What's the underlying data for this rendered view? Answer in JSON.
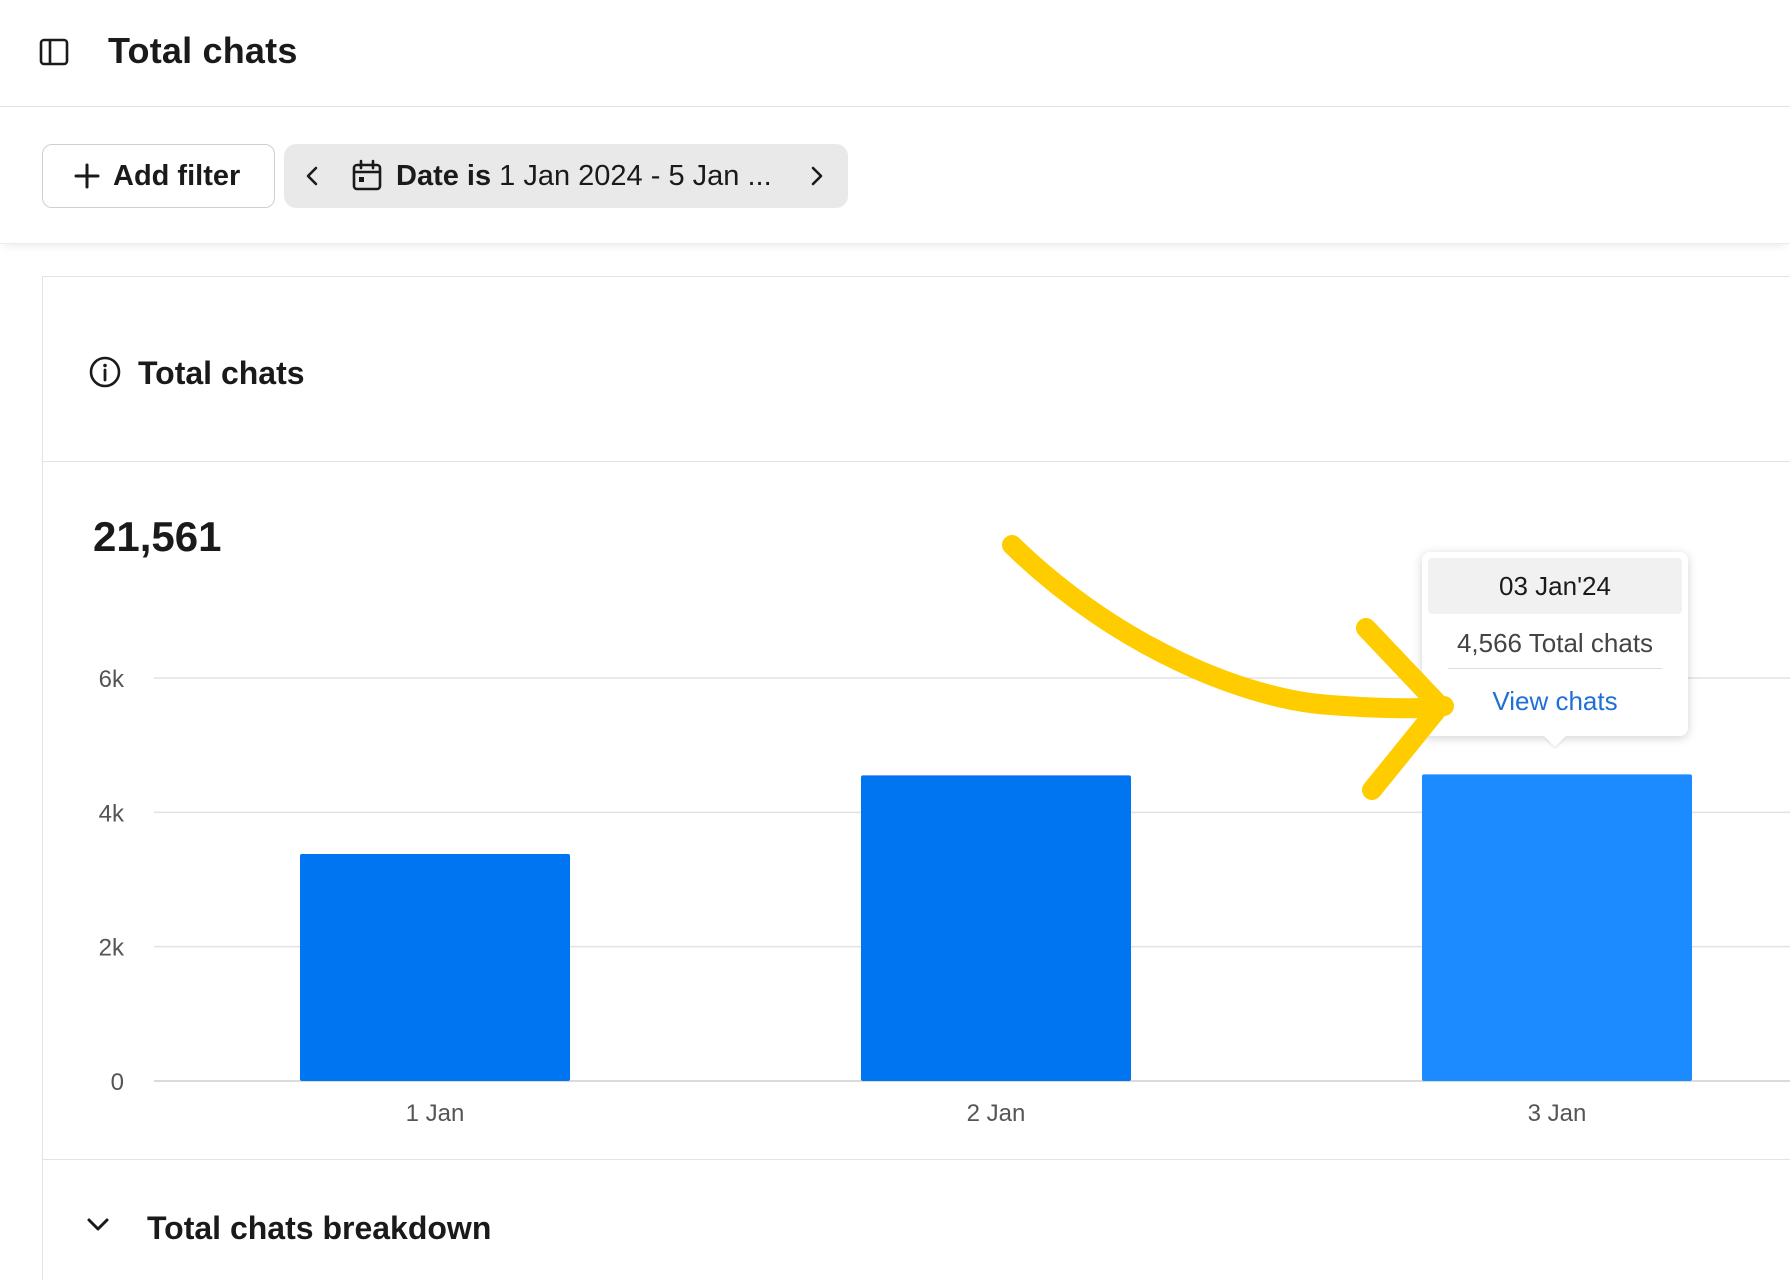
{
  "header": {
    "title": "Total chats",
    "sidebar_toggle_icon": "sidebar-toggle-icon"
  },
  "filters": {
    "add_filter_label": "Add filter",
    "date_chip": {
      "prefix": "Date is",
      "value": "1 Jan 2024 - 5 Jan ..."
    }
  },
  "card": {
    "title": "Total chats",
    "total": "21,561",
    "breakdown_label": "Total chats breakdown"
  },
  "tooltip": {
    "date": "03 Jan'24",
    "value": "4,566 Total chats",
    "link": "View chats"
  },
  "colors": {
    "bar": "#0075f2",
    "bar_hover": "#1b8bff",
    "annotation": "#ffcc00",
    "link": "#1f6fd6"
  },
  "chart_data": {
    "type": "bar",
    "categories": [
      "1 Jan",
      "2 Jan",
      "3 Jan"
    ],
    "values": [
      3380,
      4550,
      4566
    ],
    "highlighted_index": 2,
    "ylim": [
      0,
      6000
    ],
    "yticks": [
      0,
      2000,
      4000,
      6000
    ],
    "ytick_labels": [
      "0",
      "2k",
      "4k",
      "6k"
    ],
    "grid": true,
    "title": "",
    "xlabel": "",
    "ylabel": ""
  }
}
